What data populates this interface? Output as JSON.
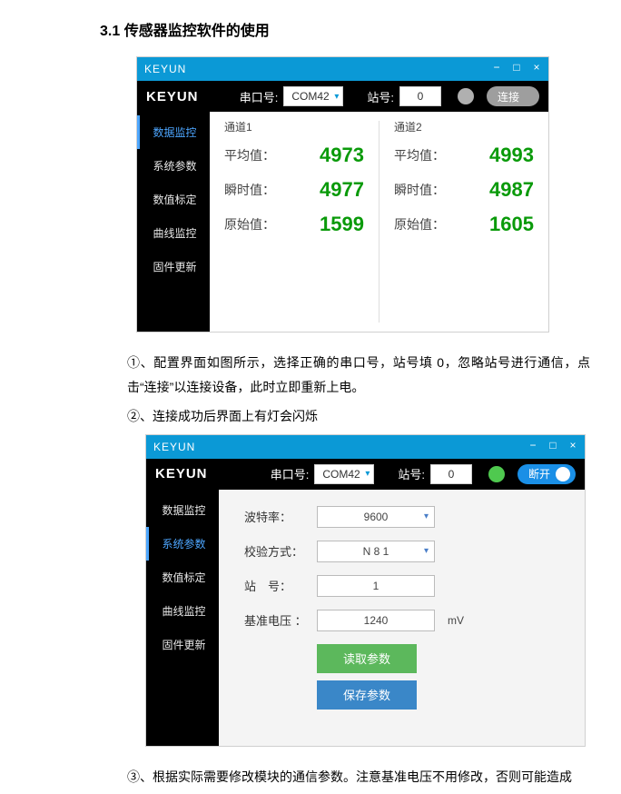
{
  "heading": "3.1 传感器监控软件的使用",
  "window1": {
    "title": "KEYUN",
    "logo": "KEYUN",
    "port_label": "串口号:",
    "port_value": "COM42",
    "station_label": "站号:",
    "station_value": "0",
    "connect_label": "连接",
    "sidebar": [
      "数据监控",
      "系统参数",
      "数值标定",
      "曲线监控",
      "固件更新"
    ],
    "active_index": 0,
    "ch1_title": "通道1",
    "ch2_title": "通道2",
    "rows": [
      {
        "label": "平均值：",
        "v1": "4973",
        "v2": "4993"
      },
      {
        "label": "瞬时值：",
        "v1": "4977",
        "v2": "4987"
      },
      {
        "label": "原始值：",
        "v1": "1599",
        "v2": "1605"
      }
    ]
  },
  "text1": "①、配置界面如图所示，选择正确的串口号，站号填 0，忽略站号进行通信，点击“连接”以连接设备，此时立即重新上电。",
  "text2": "②、连接成功后界面上有灯会闪烁",
  "window2": {
    "title": "KEYUN",
    "logo": "KEYUN",
    "port_label": "串口号:",
    "port_value": "COM42",
    "station_label": "站号:",
    "station_value": "0",
    "disconnect_label": "断开",
    "sidebar": [
      "数据监控",
      "系统参数",
      "数值标定",
      "曲线监控",
      "固件更新"
    ],
    "active_index": 1,
    "p_baud_label": "波特率：",
    "p_baud_value": "9600",
    "p_check_label": "校验方式：",
    "p_check_value": "N 8 1",
    "p_station_label": "站　号：",
    "p_station_value": "1",
    "p_ref_label": "基准电压 ：",
    "p_ref_value": "1240",
    "p_ref_unit": "mV",
    "read_btn": "读取参数",
    "save_btn": "保存参数"
  },
  "text3": "③、根据实际需要修改模块的通信参数。注意基准电压不用修改，否则可能造成"
}
